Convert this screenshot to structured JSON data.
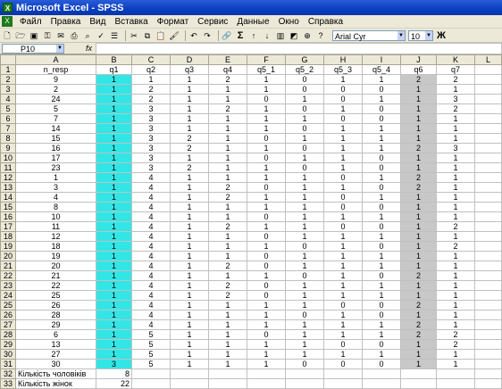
{
  "window": {
    "title": "Microsoft Excel - SPSS"
  },
  "menu": [
    "Файл",
    "Правка",
    "Вид",
    "Вставка",
    "Формат",
    "Сервис",
    "Данные",
    "Окно",
    "Справка"
  ],
  "toolbar": {
    "font": "Arial Cyr",
    "size": "10",
    "bold": "Ж",
    "sum": "Σ"
  },
  "formula_bar": {
    "cell_ref": "P10",
    "fx": "fx",
    "value": ""
  },
  "columns": [
    "A",
    "B",
    "C",
    "D",
    "E",
    "F",
    "G",
    "H",
    "I",
    "J",
    "K",
    "L"
  ],
  "header_row": [
    "n_resp",
    "q1",
    "q2",
    "q3",
    "q4",
    "q5_1",
    "q5_2",
    "q5_3",
    "q5_4",
    "q6",
    "q7",
    ""
  ],
  "rows": [
    [
      "9",
      "1",
      "1",
      "1",
      "2",
      "1",
      "0",
      "1",
      "1",
      "2",
      "2"
    ],
    [
      "2",
      "1",
      "2",
      "1",
      "1",
      "1",
      "0",
      "0",
      "0",
      "1",
      "1"
    ],
    [
      "24",
      "1",
      "2",
      "1",
      "1",
      "0",
      "1",
      "0",
      "1",
      "1",
      "3"
    ],
    [
      "5",
      "1",
      "3",
      "1",
      "2",
      "1",
      "0",
      "1",
      "0",
      "1",
      "2"
    ],
    [
      "7",
      "1",
      "3",
      "1",
      "1",
      "1",
      "1",
      "0",
      "0",
      "1",
      "1"
    ],
    [
      "14",
      "1",
      "3",
      "1",
      "1",
      "1",
      "0",
      "1",
      "1",
      "1",
      "1"
    ],
    [
      "15",
      "1",
      "3",
      "2",
      "1",
      "0",
      "1",
      "1",
      "1",
      "1",
      "1"
    ],
    [
      "16",
      "1",
      "3",
      "2",
      "1",
      "1",
      "0",
      "1",
      "1",
      "2",
      "3"
    ],
    [
      "17",
      "1",
      "3",
      "1",
      "1",
      "0",
      "1",
      "1",
      "0",
      "1",
      "1"
    ],
    [
      "23",
      "1",
      "3",
      "2",
      "1",
      "1",
      "0",
      "1",
      "0",
      "1",
      "1"
    ],
    [
      "1",
      "1",
      "4",
      "1",
      "1",
      "1",
      "1",
      "0",
      "1",
      "2",
      "1"
    ],
    [
      "3",
      "1",
      "4",
      "1",
      "2",
      "0",
      "1",
      "1",
      "0",
      "2",
      "1"
    ],
    [
      "4",
      "1",
      "4",
      "1",
      "2",
      "1",
      "1",
      "0",
      "1",
      "1",
      "1"
    ],
    [
      "8",
      "1",
      "4",
      "1",
      "1",
      "1",
      "1",
      "0",
      "0",
      "1",
      "1"
    ],
    [
      "10",
      "1",
      "4",
      "1",
      "1",
      "0",
      "1",
      "1",
      "1",
      "1",
      "1"
    ],
    [
      "11",
      "1",
      "4",
      "1",
      "2",
      "1",
      "1",
      "0",
      "0",
      "1",
      "2"
    ],
    [
      "12",
      "1",
      "4",
      "1",
      "1",
      "0",
      "1",
      "1",
      "1",
      "1",
      "1"
    ],
    [
      "18",
      "1",
      "4",
      "1",
      "1",
      "1",
      "0",
      "1",
      "0",
      "1",
      "2"
    ],
    [
      "19",
      "1",
      "4",
      "1",
      "1",
      "0",
      "1",
      "1",
      "1",
      "1",
      "1"
    ],
    [
      "20",
      "1",
      "4",
      "1",
      "2",
      "0",
      "1",
      "1",
      "1",
      "1",
      "1"
    ],
    [
      "21",
      "1",
      "4",
      "1",
      "1",
      "1",
      "0",
      "1",
      "0",
      "2",
      "1"
    ],
    [
      "22",
      "1",
      "4",
      "1",
      "2",
      "0",
      "1",
      "1",
      "1",
      "1",
      "1"
    ],
    [
      "25",
      "1",
      "4",
      "1",
      "2",
      "0",
      "1",
      "1",
      "1",
      "1",
      "1"
    ],
    [
      "26",
      "1",
      "4",
      "1",
      "1",
      "1",
      "1",
      "0",
      "0",
      "2",
      "1"
    ],
    [
      "28",
      "1",
      "4",
      "1",
      "1",
      "1",
      "0",
      "1",
      "0",
      "1",
      "1"
    ],
    [
      "29",
      "1",
      "4",
      "1",
      "1",
      "1",
      "1",
      "1",
      "1",
      "2",
      "1"
    ],
    [
      "6",
      "1",
      "5",
      "1",
      "1",
      "0",
      "1",
      "1",
      "1",
      "2",
      "2"
    ],
    [
      "13",
      "1",
      "5",
      "1",
      "1",
      "1",
      "1",
      "0",
      "0",
      "1",
      "2"
    ],
    [
      "27",
      "1",
      "5",
      "1",
      "1",
      "1",
      "1",
      "1",
      "1",
      "1",
      "1"
    ],
    [
      "30",
      "3",
      "5",
      "1",
      "1",
      "1",
      "0",
      "0",
      "0",
      "1",
      "1"
    ]
  ],
  "summary": [
    {
      "label": "Кількість чоловіків",
      "value": "8"
    },
    {
      "label": "Кількість жінок",
      "value": "22"
    }
  ],
  "colors": {
    "q1_fill": "#33e6e6",
    "q6_fill": "#c8c8c8"
  }
}
